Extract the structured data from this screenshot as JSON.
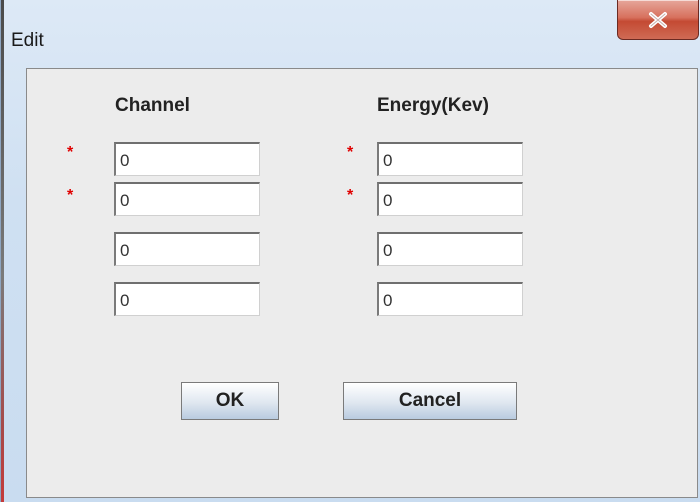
{
  "window": {
    "title": "Edit",
    "close_icon": "close-icon"
  },
  "columns": {
    "channel_label": "Channel",
    "energy_label": "Energy(Kev)"
  },
  "required_marker": "*",
  "rows": [
    {
      "required": true,
      "channel": "0",
      "energy": "0"
    },
    {
      "required": true,
      "channel": "0",
      "energy": "0"
    },
    {
      "required": false,
      "channel": "0",
      "energy": "0"
    },
    {
      "required": false,
      "channel": "0",
      "energy": "0"
    }
  ],
  "buttons": {
    "ok_label": "OK",
    "cancel_label": "Cancel"
  },
  "colors": {
    "required": "#e00000",
    "close_button": "#c44a33"
  }
}
